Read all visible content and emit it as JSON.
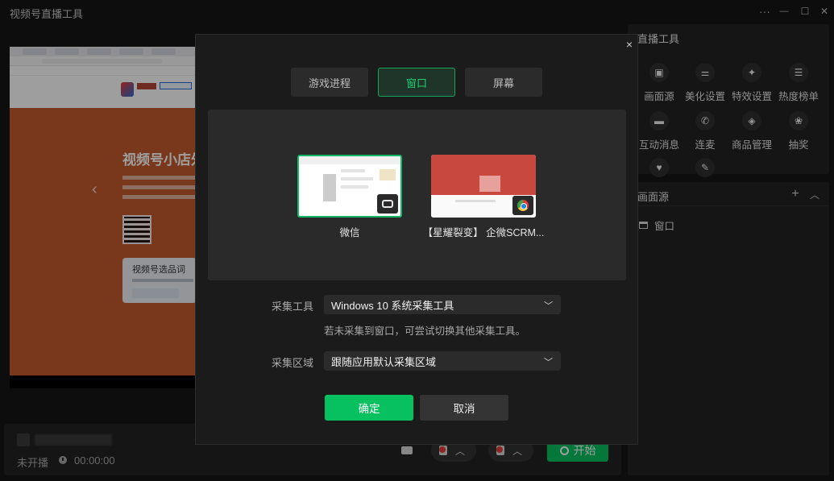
{
  "app": {
    "title": "视频号直播工具",
    "window_controls": {
      "more": "···",
      "minimize": "—",
      "maximize": "☐",
      "close": "✕"
    }
  },
  "preview": {
    "banner_title": "视频号小店外",
    "card_title": "视频号选品词"
  },
  "status": {
    "state": "未开播",
    "time": "00:00:00",
    "start_label": "开始",
    "start_color": "#07c160"
  },
  "tools": {
    "title": "直播工具",
    "items": [
      {
        "label": "画面源",
        "icon": "screen-source-icon",
        "glyph": "▣"
      },
      {
        "label": "美化设置",
        "icon": "sliders-icon",
        "glyph": "⚌"
      },
      {
        "label": "特效设置",
        "icon": "sparkle-icon",
        "glyph": "✦"
      },
      {
        "label": "热度榜单",
        "icon": "list-icon",
        "glyph": "☰"
      },
      {
        "label": "互动消息",
        "icon": "chat-icon",
        "glyph": "▬"
      },
      {
        "label": "连麦",
        "icon": "phone-icon",
        "glyph": "✆"
      },
      {
        "label": "商品管理",
        "icon": "shopping-bag-icon",
        "glyph": "◈"
      },
      {
        "label": "抽奖",
        "icon": "gift-icon",
        "glyph": "❀"
      },
      {
        "label": "",
        "icon": "heart-icon",
        "glyph": "♥"
      },
      {
        "label": "",
        "icon": "microphone-icon",
        "glyph": "✎"
      }
    ]
  },
  "sources": {
    "title": "画面源",
    "add": "+",
    "collapse": "︿",
    "items": [
      {
        "label": "窗口",
        "icon": "window-icon"
      }
    ]
  },
  "modal": {
    "close": "×",
    "tabs": [
      {
        "label": "游戏进程",
        "active": false
      },
      {
        "label": "窗口",
        "active": true
      },
      {
        "label": "屏幕",
        "active": false
      }
    ],
    "windows": [
      {
        "label": "微信",
        "selected": true,
        "app_icon": "wechat-icon"
      },
      {
        "label": "【星耀裂变】 企微SCRM...",
        "selected": false,
        "app_icon": "chrome-icon"
      }
    ],
    "capture_tool_label": "采集工具",
    "capture_tool_value": "Windows 10 系统采集工具",
    "capture_hint": "若未采集到窗口，可尝试切换其他采集工具。",
    "capture_area_label": "采集区域",
    "capture_area_value": "跟随应用默认采集区域",
    "confirm": "确定",
    "cancel": "取消",
    "accent": "#07c160"
  }
}
